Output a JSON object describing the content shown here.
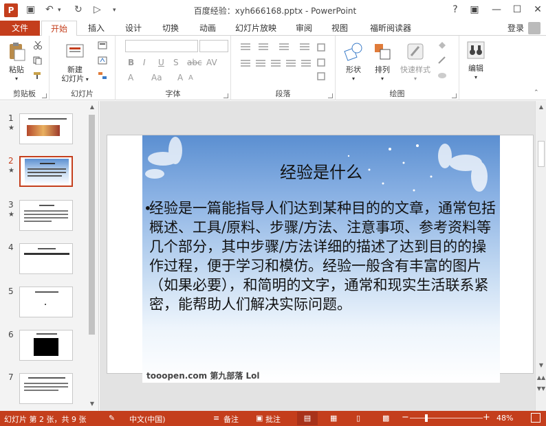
{
  "app": {
    "title": "百度经验：xyh666168.pptx - PowerPoint",
    "logo_letter": "P",
    "window_buttons": [
      "?",
      "▣",
      "—",
      "☐",
      "✕"
    ]
  },
  "tabs": {
    "file": "文件",
    "items": [
      "开始",
      "插入",
      "设计",
      "切换",
      "动画",
      "幻灯片放映",
      "审阅",
      "视图",
      "福昕阅读器"
    ],
    "active": "开始",
    "login": "登录"
  },
  "ribbon": {
    "groups": {
      "clipboard": "剪贴板",
      "slides": "幻灯片",
      "font": "字体",
      "paragraph": "段落",
      "drawing": "绘图"
    },
    "paste_label": "粘贴",
    "new_slide_label_1": "新建",
    "new_slide_label_2": "幻灯片",
    "font_buttons": [
      "B",
      "I",
      "U",
      "S",
      "abc",
      "AV"
    ],
    "font_row2": [
      "A",
      "Aa",
      "A",
      "A"
    ],
    "shape_label": "形状",
    "arrange_label": "排列",
    "quick_style_label": "快速样式",
    "edit_label": "编辑"
  },
  "thumbnails": [
    {
      "num": "1",
      "star": "★"
    },
    {
      "num": "2",
      "star": "★"
    },
    {
      "num": "3",
      "star": "★"
    },
    {
      "num": "4",
      "star": ""
    },
    {
      "num": "5",
      "star": ""
    },
    {
      "num": "6",
      "star": ""
    },
    {
      "num": "7",
      "star": ""
    }
  ],
  "slide": {
    "title": "经验是什么",
    "bullet": "•",
    "body": "经验是一篇能指导人们达到某种目的的文章，通常包括概述、工具/原料、步骤/方法、注意事项、参考资料等几个部分，其中步骤/方法详细的描述了达到目的的操作过程，便于学习和模仿。经验一般含有丰富的图片（如果必要），和简明的文字，通常和现实生活联系紧密，能帮助人们解决实际问题。",
    "watermark": "tooopen.com 第九部落 Lol"
  },
  "statusbar": {
    "slide_info": "幻灯片 第 2 张，共 9 张",
    "language": "中文(中国)",
    "notes": "备注",
    "comments": "批注",
    "zoom": "48%",
    "zoom_fraction": 0.48
  },
  "colors": {
    "accent": "#c43e1c"
  }
}
